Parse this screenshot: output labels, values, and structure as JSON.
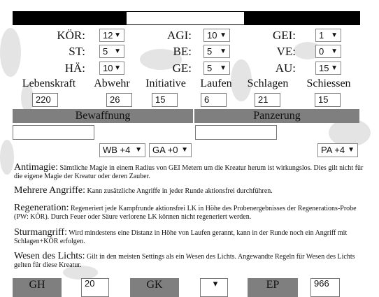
{
  "header": {
    "name_value": ""
  },
  "attributes": [
    {
      "label": "KÖR:",
      "value": "12"
    },
    {
      "label": "AGI:",
      "value": "10"
    },
    {
      "label": "GEI:",
      "value": "1"
    },
    {
      "label": "ST:",
      "value": "5"
    },
    {
      "label": "BE:",
      "value": "5"
    },
    {
      "label": "VE:",
      "value": "0"
    },
    {
      "label": "HÄ:",
      "value": "10"
    },
    {
      "label": "GE:",
      "value": "5"
    },
    {
      "label": "AU:",
      "value": "15"
    }
  ],
  "stats": [
    {
      "label": "Lebenskraft",
      "value": "220"
    },
    {
      "label": "Abwehr",
      "value": "26"
    },
    {
      "label": "Initiative",
      "value": "15"
    },
    {
      "label": "Laufen",
      "value": "6"
    },
    {
      "label": "Schlagen",
      "value": "21"
    },
    {
      "label": "Schiessen",
      "value": "15"
    }
  ],
  "sections": {
    "weapons_label": "Bewaffnung",
    "armor_label": "Panzerung"
  },
  "bonuses": {
    "wb": "WB +4",
    "ga": "GA +0",
    "pa": "PA +4"
  },
  "traits": [
    {
      "name": "Antimagie:",
      "text": "Sämtliche Magie in einem Radius von GEI Metern um die Kreatur herum ist wirkungslos. Dies gilt nicht für die eigene Magie der Kreatur oder deren Zauber."
    },
    {
      "name": "Mehrere Angriffe:",
      "text": "Kann zusätzliche Angriffe in jeder Runde aktionsfrei durchführen."
    },
    {
      "name": "Regeneration:",
      "text": "Regeneriert jede Kampfrunde aktionsfrei LK in Höhe des Probenergebnisses der Regenerations-Probe (PW: KÖR). Durch Feuer oder Säure verlorene LK können nicht regeneriert werden."
    },
    {
      "name": "Sturmangriff:",
      "text": "Wird mindestens eine Distanz in Höhe von Laufen gerannt, kann in der Runde noch ein Angriff mit Schlagen+KÖR erfolgen."
    },
    {
      "name": "Wesen des Lichts:",
      "text": "Gilt in den meisten Settings als ein Wesen des Lichts. Angewandte Regeln für Wesen des Lichts gelten für diese Kreatur."
    }
  ],
  "footer": [
    {
      "label": "GH",
      "value": "20"
    },
    {
      "label": "GK",
      "value": "▾"
    },
    {
      "label": "EP",
      "value": "966"
    }
  ],
  "colors": {
    "band": "#7f7f7f",
    "bar": "#000000",
    "splatter": "#e4e4e4"
  }
}
